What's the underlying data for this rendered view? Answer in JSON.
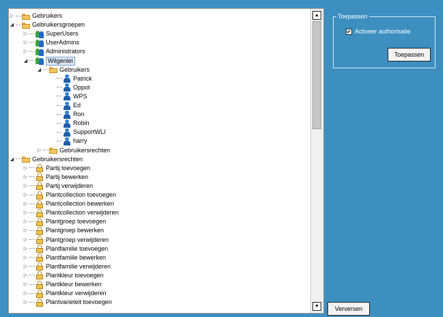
{
  "tree": {
    "nodes": [
      {
        "label": "Gebruikers",
        "icon": "folder-icon",
        "depth": 0,
        "expander": "collapsed"
      },
      {
        "label": "Gebruikersgroepen",
        "icon": "folder-icon",
        "depth": 0,
        "expander": "expanded"
      },
      {
        "label": "SuperUsers",
        "icon": "group-icon",
        "depth": 1,
        "expander": "collapsed"
      },
      {
        "label": "UserAdmins",
        "icon": "group-icon",
        "depth": 1,
        "expander": "collapsed"
      },
      {
        "label": "Administrators",
        "icon": "group-icon",
        "depth": 1,
        "expander": "collapsed"
      },
      {
        "label": "Wilgenlei",
        "icon": "group-icon",
        "depth": 1,
        "expander": "expanded",
        "selected": true
      },
      {
        "label": "Gebruikers",
        "icon": "folder-icon",
        "depth": 2,
        "expander": "expanded"
      },
      {
        "label": "Patrick",
        "icon": "user-icon",
        "depth": 3,
        "expander": "none"
      },
      {
        "label": "Oppot",
        "icon": "user-icon",
        "depth": 3,
        "expander": "none"
      },
      {
        "label": "WPS",
        "icon": "user-icon",
        "depth": 3,
        "expander": "none"
      },
      {
        "label": "Ed",
        "icon": "user-icon",
        "depth": 3,
        "expander": "none"
      },
      {
        "label": "Ron",
        "icon": "user-icon",
        "depth": 3,
        "expander": "none"
      },
      {
        "label": "Robin",
        "icon": "user-icon",
        "depth": 3,
        "expander": "none"
      },
      {
        "label": "SupportWLI",
        "icon": "user-icon",
        "depth": 3,
        "expander": "none"
      },
      {
        "label": "harry",
        "icon": "user-icon",
        "depth": 3,
        "expander": "none"
      },
      {
        "label": "Gebruikersrechten",
        "icon": "folder-icon",
        "depth": 2,
        "expander": "collapsed"
      },
      {
        "label": "Gebruikersrechten",
        "icon": "folder-icon",
        "depth": 0,
        "expander": "expanded"
      },
      {
        "label": "Partij toevoegen",
        "icon": "lock-icon",
        "depth": 1,
        "expander": "collapsed"
      },
      {
        "label": "Partij bewerken",
        "icon": "lock-icon",
        "depth": 1,
        "expander": "collapsed"
      },
      {
        "label": "Partij verwijderen",
        "icon": "lock-icon",
        "depth": 1,
        "expander": "collapsed"
      },
      {
        "label": "Plantcollection toevoegen",
        "icon": "lock-icon",
        "depth": 1,
        "expander": "collapsed"
      },
      {
        "label": "Plantcollection bewerken",
        "icon": "lock-icon",
        "depth": 1,
        "expander": "collapsed"
      },
      {
        "label": "Plantcollection verwijderen",
        "icon": "lock-icon",
        "depth": 1,
        "expander": "collapsed"
      },
      {
        "label": "Plantgroep toevoegen",
        "icon": "lock-icon",
        "depth": 1,
        "expander": "collapsed"
      },
      {
        "label": "Plantgroep bewerken",
        "icon": "lock-icon",
        "depth": 1,
        "expander": "collapsed"
      },
      {
        "label": "Plantgroep verwijderen",
        "icon": "lock-icon",
        "depth": 1,
        "expander": "collapsed"
      },
      {
        "label": "Plantfamilie toevoegen",
        "icon": "lock-icon",
        "depth": 1,
        "expander": "collapsed"
      },
      {
        "label": "Plantfamilie bewerken",
        "icon": "lock-icon",
        "depth": 1,
        "expander": "collapsed"
      },
      {
        "label": "Plantfamilie verwijderen",
        "icon": "lock-icon",
        "depth": 1,
        "expander": "collapsed"
      },
      {
        "label": "Plantkleur toevoegen",
        "icon": "lock-icon",
        "depth": 1,
        "expander": "collapsed"
      },
      {
        "label": "Plantkleur bewerken",
        "icon": "lock-icon",
        "depth": 1,
        "expander": "collapsed"
      },
      {
        "label": "Plantkleur verwijderen",
        "icon": "lock-icon",
        "depth": 1,
        "expander": "collapsed"
      },
      {
        "label": "Plantvarieteit toevoegen",
        "icon": "lock-icon",
        "depth": 1,
        "expander": "collapsed"
      }
    ]
  },
  "scrollbar": {
    "up_icon": "arrow-up-icon",
    "down_icon": "arrow-down-icon"
  },
  "toepassen": {
    "legend": "Toepassen",
    "checkbox_label": "Activeer authorisatie",
    "checkbox_checked": true,
    "button_label": "Toepassen"
  },
  "verversen_label": "Verversen",
  "colors": {
    "background": "#3c8fbf",
    "selection": "#dbe9f7"
  }
}
